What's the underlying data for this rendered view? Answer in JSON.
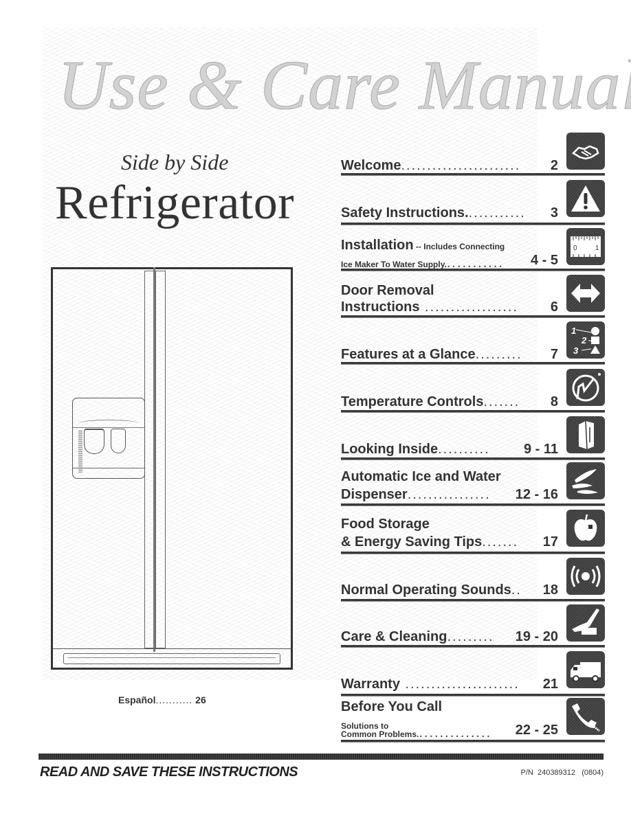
{
  "cover": {
    "title": "Use & Care Manual",
    "subtitle": "Side by Side",
    "product": "Refrigerator",
    "illustration": "side-by-side-refrigerator-with-ice-water-dispenser"
  },
  "espanol": {
    "label": "Español",
    "dots": "...........",
    "page": "26"
  },
  "toc": [
    {
      "title": "Welcome",
      "dots": ".......................",
      "page": "2",
      "icon": "handshake-icon"
    },
    {
      "title": "Safety Instructions.",
      "dots": "...........",
      "page": "3",
      "icon": "warning-icon"
    },
    {
      "title": "Installation",
      "subtitle_inline": " -- Includes Connecting",
      "line2": "Ice Maker To Water Supply.",
      "dots": "...........",
      "page": "4 - 5",
      "icon": "ruler-icon"
    },
    {
      "title": "Door Removal",
      "line2": "Instructions",
      "dots": " ..................",
      "page": "6",
      "icon": "double-arrow-icon"
    },
    {
      "title": "Features at a Glance",
      "dots": ".........",
      "page": "7",
      "icon": "numbered-shapes-icon"
    },
    {
      "title": "Temperature Controls",
      "dots": ".......",
      "page": "8",
      "icon": "dial-hand-icon"
    },
    {
      "title": "Looking Inside",
      "dots": "..........",
      "page": "9 - 11",
      "icon": "fridge-icon"
    },
    {
      "title": "Automatic Ice and Water",
      "line2": "Dispenser",
      "dots": "................",
      "page": "12 - 16",
      "icon": "ice-icon"
    },
    {
      "title": "Food Storage",
      "line2": "& Energy Saving Tips",
      "dots": ".......",
      "page": "17",
      "icon": "apple-icon"
    },
    {
      "title": "Normal Operating Sounds",
      "dots": "..",
      "page": "18",
      "icon": "sound-icon"
    },
    {
      "title": "Care & Cleaning",
      "dots": ".........",
      "page": "19 - 20",
      "icon": "cleaning-hand-icon"
    },
    {
      "title": "Warranty",
      "dots": " ......................",
      "page": "21",
      "icon": "truck-icon"
    },
    {
      "title": "Before You Call",
      "line2a": "Solutions to",
      "line2": "Common Problems.",
      "dots": "..............",
      "page": "22 - 25",
      "icon": "phone-icon"
    }
  ],
  "footer": {
    "left": "READ AND SAVE THESE INSTRUCTIONS",
    "right": "P/N  240389312   (0804)"
  }
}
